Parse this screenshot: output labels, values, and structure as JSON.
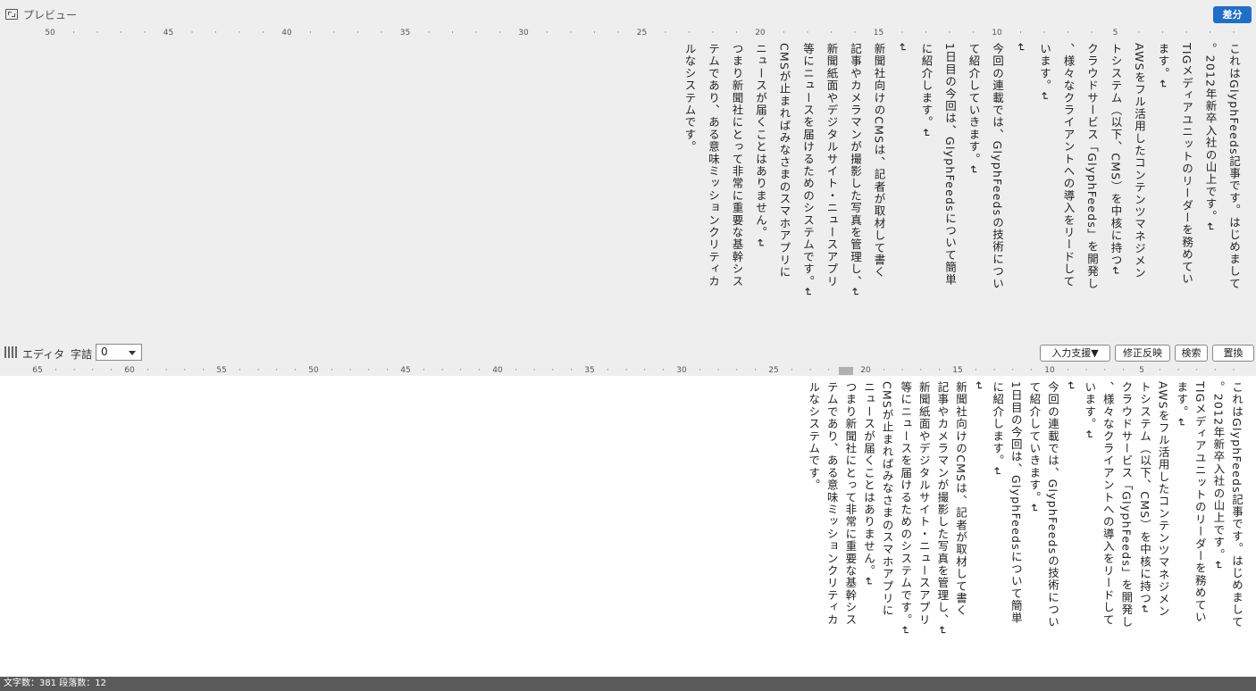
{
  "preview": {
    "title": "プレビュー",
    "diff_button": "差分",
    "ruler_labels": [
      "5",
      "10",
      "15",
      "20",
      "25",
      "30",
      "35",
      "40",
      "45",
      "50"
    ],
    "lines": [
      "これはGlyphFeeds記事です。はじめまして",
      "。2012年新卒入社の山上です。↵",
      "TIGメディアユニットのリーダーを務めてい",
      "ます。↵",
      "AWSをフル活用したコンテンツマネジメン",
      "トシステム（以下、CMS）を中核に持つ↵",
      "クラウドサービス「GlyphFeeds」を開発し",
      "、様々なクライアントへの導入をリードして",
      "います。↵",
      "↵",
      "今回の連載では、GlyphFeedsの技術につい",
      "て紹介していきます。↵",
      "1日目の今回は、GlyphFeedsについて簡単",
      "に紹介します。↵",
      "↵",
      "新聞社向けのCMSは、記者が取材して書く",
      "記事やカメラマンが撮影した写真を管理し、↵",
      "新聞紙面やデジタルサイト・ニュースアプリ",
      "等にニュースを届けるためのシステムです。↵",
      "CMSが止まればみなさまのスマホアプリに",
      "ニュースが届くことはありません。↵",
      "つまり新聞社にとって非常に重要な基幹シス",
      "テムであり、ある意味ミッションクリティカ",
      "ルなシステムです。"
    ]
  },
  "editor": {
    "label": "エディタ",
    "jiduime_label": "字詰",
    "jiduime_value": "0",
    "buttons": {
      "input_assist": "入力支援▼",
      "apply_fix": "修正反映",
      "search": "検索",
      "replace": "置換"
    },
    "ruler_labels": [
      "5",
      "10",
      "15",
      "20",
      "25",
      "30",
      "35",
      "40",
      "45",
      "50",
      "55",
      "60",
      "65"
    ],
    "lines": [
      "これはGlyphFeeds記事です。はじめまして",
      "。2012年新卒入社の山上です。↵",
      "TIGメディアユニットのリーダーを務めてい",
      "ます。↵",
      "AWSをフル活用したコンテンツマネジメン",
      "トシステム（以下、CMS）を中核に持つ↵",
      "クラウドサービス「GlyphFeeds」を開発し",
      "、様々なクライアントへの導入をリードして",
      "います。↵",
      "↵",
      "今回の連載では、GlyphFeedsの技術につい",
      "て紹介していきます。↵",
      "1日目の今回は、GlyphFeedsについて簡単",
      "に紹介します。↵",
      "↵",
      "新聞社向けのCMSは、記者が取材して書く",
      "記事やカメラマンが撮影した写真を管理し、↵",
      "新聞紙面やデジタルサイト・ニュースアプリ",
      "等にニュースを届けるためのシステムです。↵",
      "CMSが止まればみなさまのスマホアプリに",
      "ニュースが届くことはありません。↵",
      "つまり新聞社にとって非常に重要な基幹シス",
      "テムであり、ある意味ミッションクリティカ",
      "ルなシステムです。"
    ]
  },
  "status": {
    "text": "文字数：381  段落数：12"
  }
}
